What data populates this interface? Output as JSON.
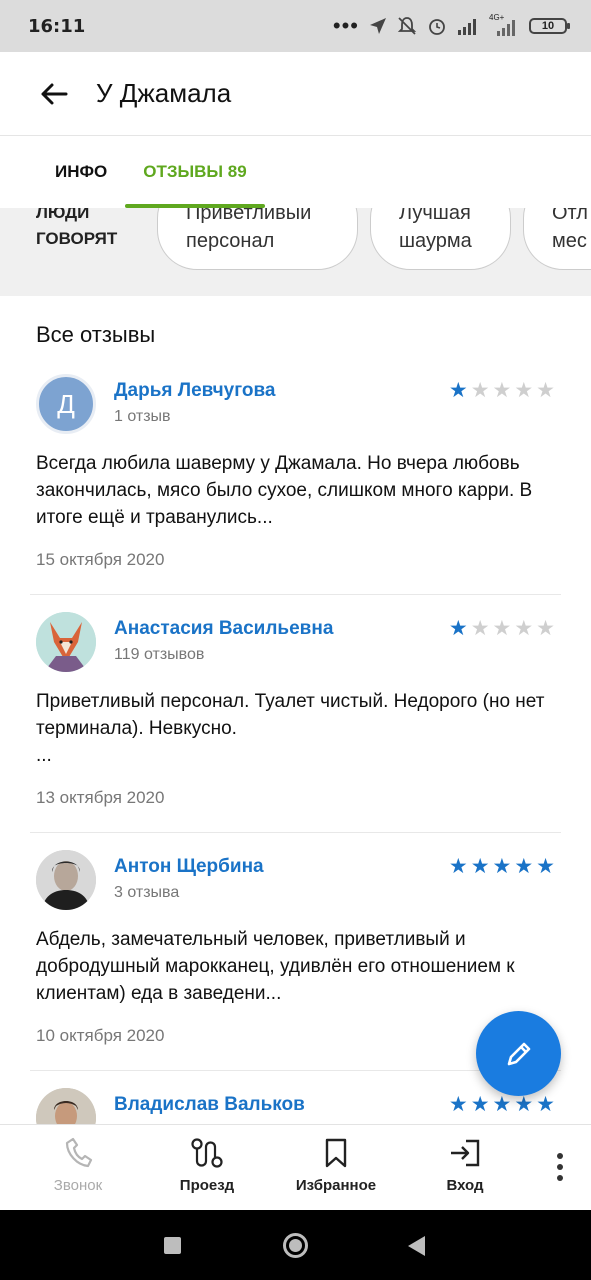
{
  "status": {
    "time": "16:11",
    "signal_text": "4G+",
    "battery": "10"
  },
  "header": {
    "title": "У Джамала"
  },
  "tabs": [
    {
      "label": "ИНФО"
    },
    {
      "label": "ОТЗЫВЫ 89"
    }
  ],
  "tags": {
    "label_line1": "ЛЮДИ",
    "label_line2": "ГОВОРЯТ",
    "chips": [
      {
        "line1": "Приветливый",
        "line2": "персонал"
      },
      {
        "line1": "Лучшая",
        "line2": "шаурма"
      },
      {
        "line1": "Отл",
        "line2": "мес"
      }
    ]
  },
  "section_title": "Все отзывы",
  "reviews": [
    {
      "avatar_letter": "Д",
      "name": "Дарья Левчугова",
      "count": "1 отзыв",
      "rating": 1,
      "text": "Всегда любила шаверму у Джамала. Но вчера любовь закончилась, мясо было сухое, слишком много карри. В итоге ещё и траванулись...",
      "date": "15 октября 2020"
    },
    {
      "avatar_letter": "",
      "name": "Анастасия Васильевна",
      "count": "119 отзывов",
      "rating": 1,
      "text": "Приветливый персонал. Туалет чистый. Недорого (но нет терминала). Невкусно.\n...",
      "date": "13 октября 2020"
    },
    {
      "avatar_letter": "",
      "name": "Антон Щербина",
      "count": "3 отзыва",
      "rating": 5,
      "text": "Абдель, замечательный человек, приветливый и добродушный марокканец, удивлён его отношением к клиентам) еда в заведени...",
      "date": "10 октября 2020"
    },
    {
      "avatar_letter": "",
      "name": "Владислав Вальков",
      "count": "",
      "rating": 5,
      "text": "",
      "date": ""
    }
  ],
  "bottom_nav": {
    "call": "Звонок",
    "route": "Проезд",
    "favorites": "Избранное",
    "login": "Вход"
  },
  "colors": {
    "accent_green": "#5fa81f",
    "link_blue": "#1a73c7",
    "fab_blue": "#1a7ce0"
  }
}
